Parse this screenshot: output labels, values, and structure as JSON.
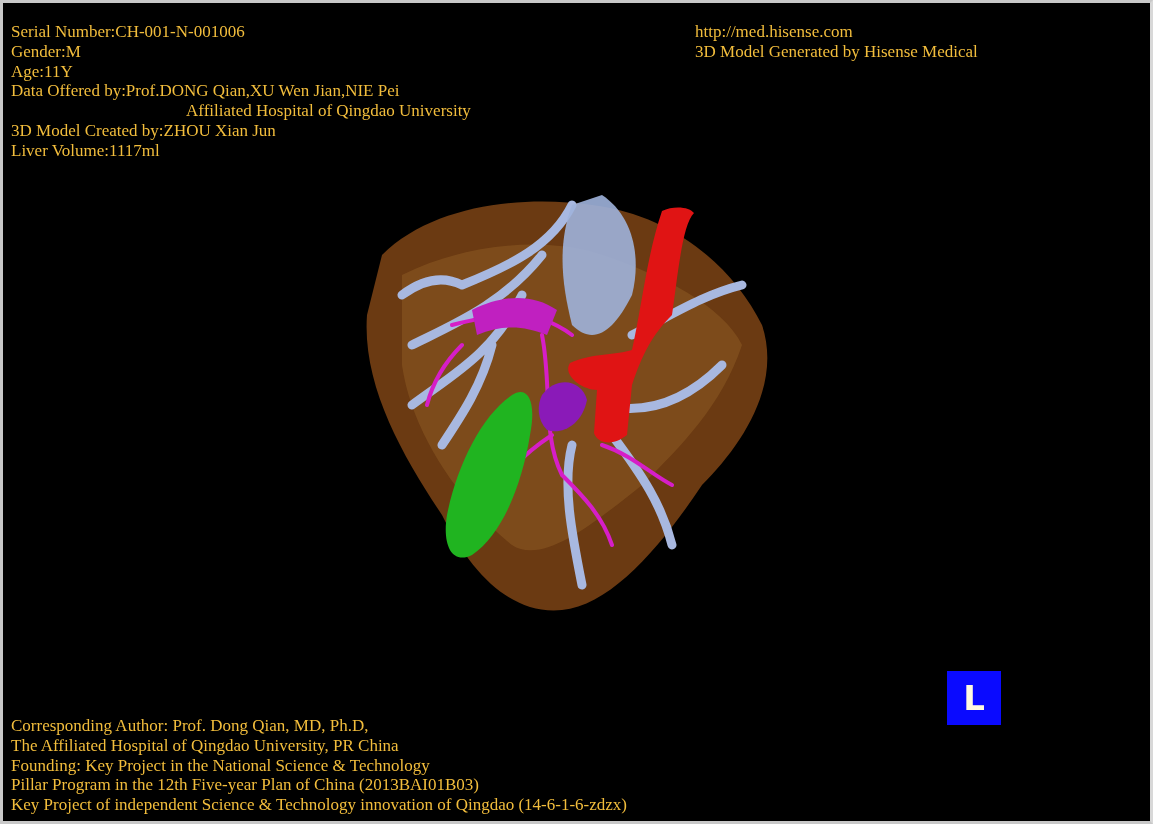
{
  "header_left": [
    {
      "text": "Serial Number:CH-001-N-001006",
      "kind": "line"
    },
    {
      "text": "Gender:M",
      "kind": "line"
    },
    {
      "text": "Age:11Y",
      "kind": "line"
    },
    {
      "text": "Data Offered by:Prof.DONG Qian,XU Wen Jian,NIE Pei",
      "kind": "line"
    },
    {
      "text": "Affiliated Hospital of Qingdao University",
      "kind": "continuation"
    },
    {
      "text": "3D Model Created by:ZHOU Xian Jun",
      "kind": "line"
    },
    {
      "text": "Liver Volume:1117ml",
      "kind": "line"
    }
  ],
  "header_right": [
    {
      "text": "http://med.hisense.com",
      "kind": "line"
    },
    {
      "text": "3D Model Generated by Hisense Medical",
      "kind": "line"
    }
  ],
  "orientation_marker": {
    "label": "L"
  },
  "footer": [
    {
      "text": "Corresponding Author: Prof. Dong Qian, MD, Ph.D,",
      "kind": "line"
    },
    {
      "text": "The Affiliated Hospital of Qingdao University, PR China",
      "kind": "line"
    },
    {
      "text": "Founding: Key Project in the National Science & Technology",
      "kind": "line"
    },
    {
      "text": "Pillar Program in the 12th Five-year Plan of China (2013BAI01B03)",
      "kind": "line"
    },
    {
      "text": "Key Project of independent Science & Technology innovation of Qingdao (14-6-1-6-zdzx)",
      "kind": "line"
    }
  ]
}
